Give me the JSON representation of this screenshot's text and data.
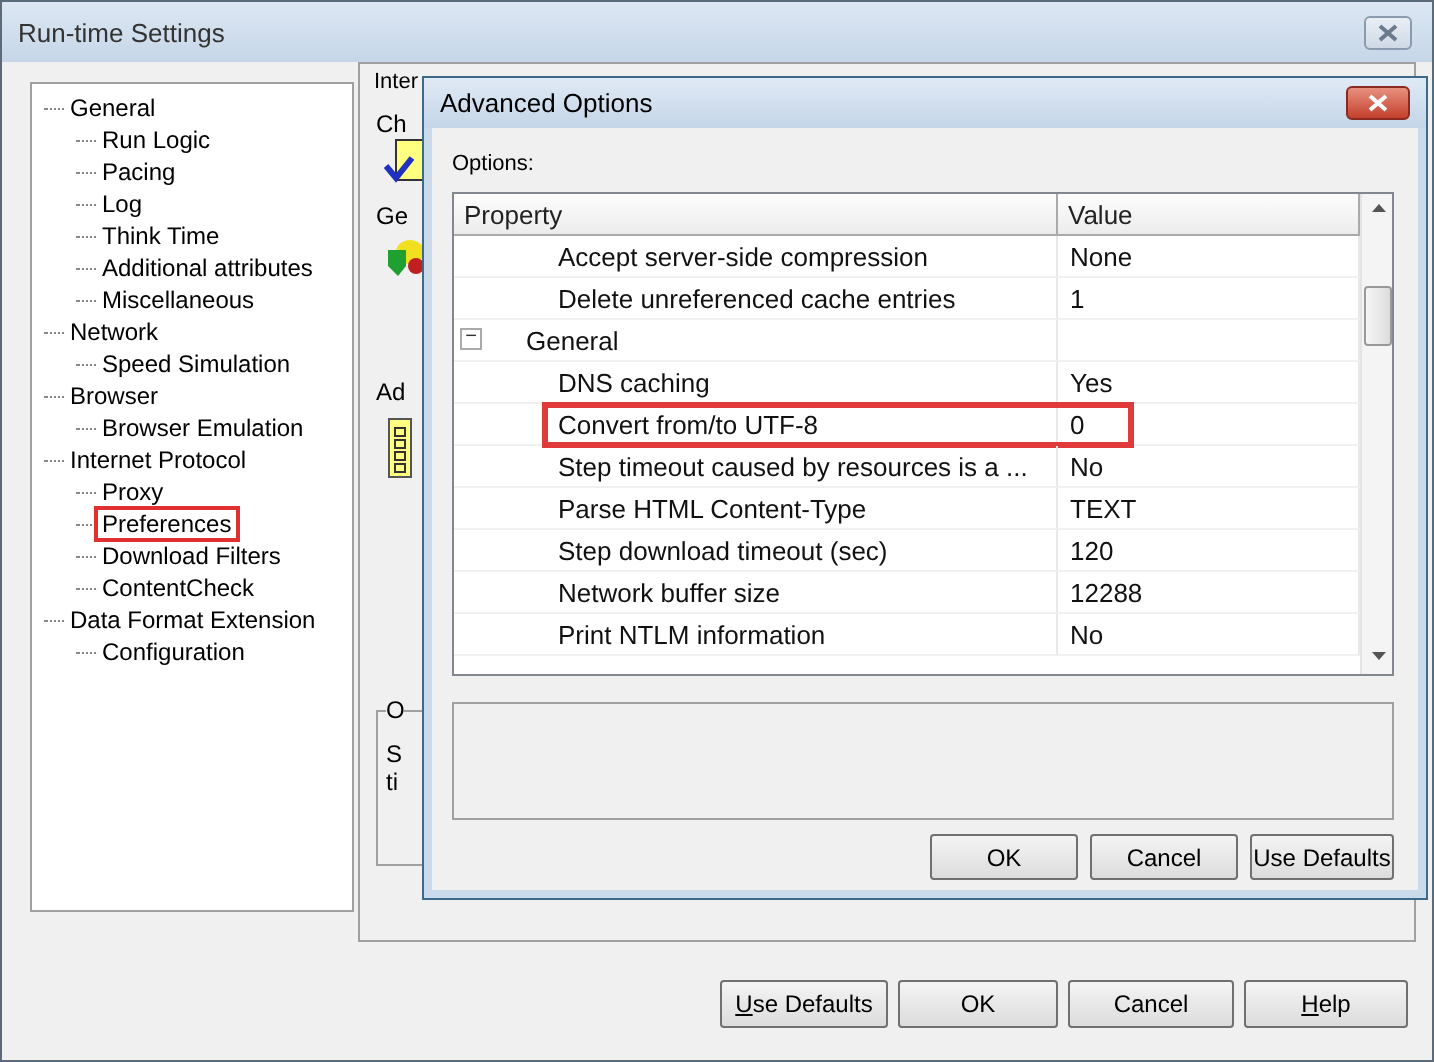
{
  "window": {
    "title": "Run-time Settings"
  },
  "tree": [
    {
      "label": "General",
      "highlighted": false,
      "children": [
        {
          "label": "Run Logic",
          "highlighted": false
        },
        {
          "label": "Pacing",
          "highlighted": false
        },
        {
          "label": "Log",
          "highlighted": false
        },
        {
          "label": "Think Time",
          "highlighted": false
        },
        {
          "label": "Additional attributes",
          "highlighted": false
        },
        {
          "label": "Miscellaneous",
          "highlighted": false
        }
      ]
    },
    {
      "label": "Network",
      "highlighted": false,
      "children": [
        {
          "label": "Speed Simulation",
          "highlighted": false
        }
      ]
    },
    {
      "label": "Browser",
      "highlighted": false,
      "children": [
        {
          "label": "Browser Emulation",
          "highlighted": false
        }
      ]
    },
    {
      "label": "Internet Protocol",
      "highlighted": false,
      "children": [
        {
          "label": "Proxy",
          "highlighted": false
        },
        {
          "label": "Preferences",
          "highlighted": true
        },
        {
          "label": "Download Filters",
          "highlighted": false
        },
        {
          "label": "ContentCheck",
          "highlighted": false
        }
      ]
    },
    {
      "label": "Data Format Extension",
      "highlighted": false,
      "children": [
        {
          "label": "Configuration",
          "highlighted": false
        }
      ]
    }
  ],
  "pane": {
    "group_label": "Inter",
    "labels": [
      "Ch",
      "Ge",
      "Ad"
    ],
    "lower_group_label": "O",
    "lower_texts": [
      "S",
      "ti"
    ]
  },
  "buttons": [
    {
      "mnemonic": "U",
      "rest": "se Defaults"
    },
    {
      "rest": "OK"
    },
    {
      "rest": "Cancel"
    },
    {
      "mnemonic": "H",
      "rest": "elp"
    }
  ],
  "dialog": {
    "title": "Advanced Options",
    "options_label": "Options:",
    "columns": [
      "Property",
      "Value"
    ],
    "rows": [
      {
        "kind": "property",
        "property": "Accept server-side compression",
        "value": "None",
        "highlighted": false
      },
      {
        "kind": "property",
        "property": "Delete unreferenced cache entries",
        "value": "1",
        "highlighted": false
      },
      {
        "kind": "group",
        "property": "General",
        "expander": "−",
        "highlighted": false
      },
      {
        "kind": "property",
        "property": "DNS caching",
        "value": "Yes",
        "highlighted": false
      },
      {
        "kind": "property",
        "property": "Convert from/to UTF-8",
        "value": "0",
        "highlighted": true
      },
      {
        "kind": "property",
        "property": "Step timeout caused by resources is a ...",
        "value": "No",
        "highlighted": false
      },
      {
        "kind": "property",
        "property": "Parse HTML Content-Type",
        "value": "TEXT",
        "highlighted": false
      },
      {
        "kind": "property",
        "property": "Step download timeout (sec)",
        "value": "120",
        "highlighted": false
      },
      {
        "kind": "property",
        "property": "Network buffer size",
        "value": "12288",
        "highlighted": false
      },
      {
        "kind": "property",
        "property": "Print NTLM information",
        "value": "No",
        "highlighted": false
      }
    ],
    "buttons": [
      "OK",
      "Cancel",
      "Use Defaults"
    ]
  }
}
